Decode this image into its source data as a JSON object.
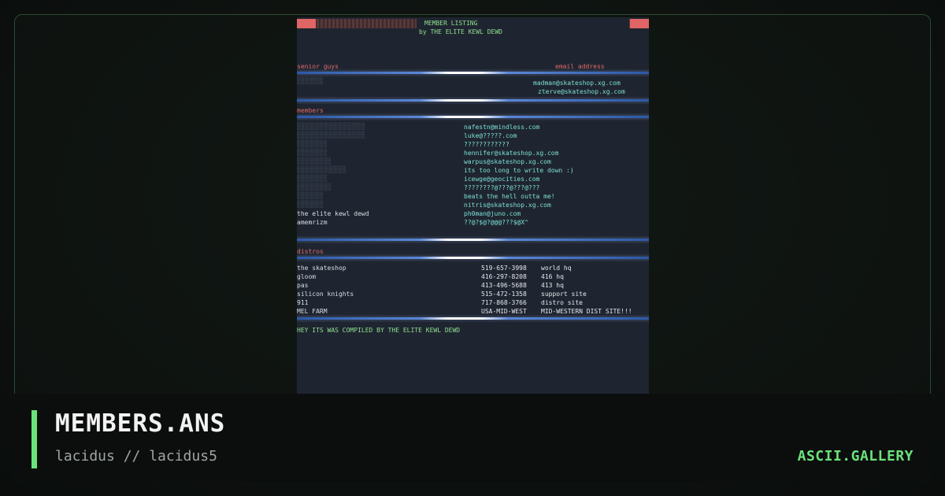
{
  "artwork": {
    "title": "MEMBER LISTING",
    "subtitle": "by THE ELITE KEWL DEWD",
    "senior_header": "senior guys",
    "email_header": "email address",
    "senior_emails": [
      "madman@skateshop.xg.com",
      "zterve@skateshop.xg.com"
    ],
    "members_header": "members",
    "members": [
      {
        "name": "",
        "email": "nafestn@mindless.com"
      },
      {
        "name": "",
        "email": "luke@?????.com"
      },
      {
        "name": "",
        "email": "????????????"
      },
      {
        "name": "",
        "email": "hennifer@skateshop.xg.com"
      },
      {
        "name": "",
        "email": "warpus@skateshop.xg.com"
      },
      {
        "name": "",
        "email": "its too long to write down :)"
      },
      {
        "name": "",
        "email": "icewge@geocities.com"
      },
      {
        "name": "",
        "email": "????????@???@???@???"
      },
      {
        "name": "",
        "email": "beats the hell outta me!"
      },
      {
        "name": "",
        "email": "nitris@skateshop.xg.com"
      },
      {
        "name": "the elite kewl dewd",
        "email": "ph0man@juno.com"
      },
      {
        "name": "amemrizm",
        "email": "??@?$@?@@@???$@X^"
      }
    ],
    "distros_header": "distros",
    "distros": [
      {
        "name": "the skateshop",
        "phone": "519-657-3998",
        "note": "world hq"
      },
      {
        "name": "gloom",
        "phone": "416-297-8208",
        "note": "416 hq"
      },
      {
        "name": "pas",
        "phone": "413-496-5688",
        "note": "413 hq"
      },
      {
        "name": "silicon knights",
        "phone": "515-472-1358",
        "note": "support site"
      },
      {
        "name": "911",
        "phone": "717-868-3766",
        "note": "distro site"
      },
      {
        "name": "MEL FARM",
        "phone": "USA-MID-WEST",
        "note": "MID-WESTERN DIST SITE!!!"
      }
    ],
    "footer": "HEY ITS WAS COMPILED BY THE ELITE KEWL DEWD"
  },
  "caption": {
    "title": "MEMBERS.ANS",
    "author": "lacidus // lacidus5",
    "brand": "ASCII.GALLERY"
  },
  "colors": {
    "accent": "#6ce27a",
    "email_text": "#7ce0d6",
    "header_text": "#e06a6a",
    "title_text": "#8fe08f",
    "rule": "#5a86d6"
  }
}
